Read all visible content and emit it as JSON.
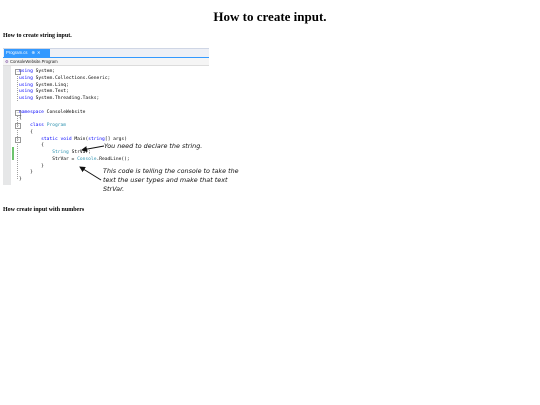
{
  "page": {
    "title": "How to create input."
  },
  "sections": {
    "string_input": "How to create string input.",
    "numbers_input": "How create input with numbers"
  },
  "ide": {
    "tab_label": "Program.cs",
    "tab_pin": "⊕",
    "tab_close": "✕",
    "nav_path": "ConsoleWebsite.Program",
    "code_lines": [
      [
        {
          "t": "using",
          "c": "kw"
        },
        {
          "t": " System;"
        }
      ],
      [
        {
          "t": "using",
          "c": "kw"
        },
        {
          "t": " System.Collections.Generic;"
        }
      ],
      [
        {
          "t": "using",
          "c": "kw"
        },
        {
          "t": " System.Linq;"
        }
      ],
      [
        {
          "t": "using",
          "c": "kw"
        },
        {
          "t": " System.Text;"
        }
      ],
      [
        {
          "t": "using",
          "c": "kw"
        },
        {
          "t": " System.Threading.Tasks;"
        }
      ],
      [
        {
          "t": ""
        }
      ],
      [
        {
          "t": "namespace",
          "c": "kw"
        },
        {
          "t": " ConsoleWebsite"
        }
      ],
      [
        {
          "t": "{"
        }
      ],
      [
        {
          "t": "    "
        },
        {
          "t": "class",
          "c": "kw"
        },
        {
          "t": " "
        },
        {
          "t": "Program",
          "c": "ty"
        }
      ],
      [
        {
          "t": "    {"
        }
      ],
      [
        {
          "t": "        "
        },
        {
          "t": "static",
          "c": "kw"
        },
        {
          "t": " "
        },
        {
          "t": "void",
          "c": "kw"
        },
        {
          "t": " Main("
        },
        {
          "t": "string",
          "c": "kw"
        },
        {
          "t": "[] args)"
        }
      ],
      [
        {
          "t": "        {"
        }
      ],
      [
        {
          "t": "            "
        },
        {
          "t": "String",
          "c": "ty"
        },
        {
          "t": " StrVar;"
        }
      ],
      [
        {
          "t": "            StrVar = "
        },
        {
          "t": "Console",
          "c": "ty"
        },
        {
          "t": ".ReadLine();"
        }
      ],
      [
        {
          "t": "        }"
        }
      ],
      [
        {
          "t": "    }"
        }
      ],
      [
        {
          "t": "}"
        }
      ]
    ]
  },
  "annotations": {
    "declare": "You need to declare the string.",
    "console_explain": "This code is telling the console to take the text the user types and make that text StrVar."
  },
  "colors": {
    "keyword": "#0000ff",
    "type": "#2b91af",
    "tab_active": "#3399ff",
    "change_bar": "#6dc46d"
  }
}
